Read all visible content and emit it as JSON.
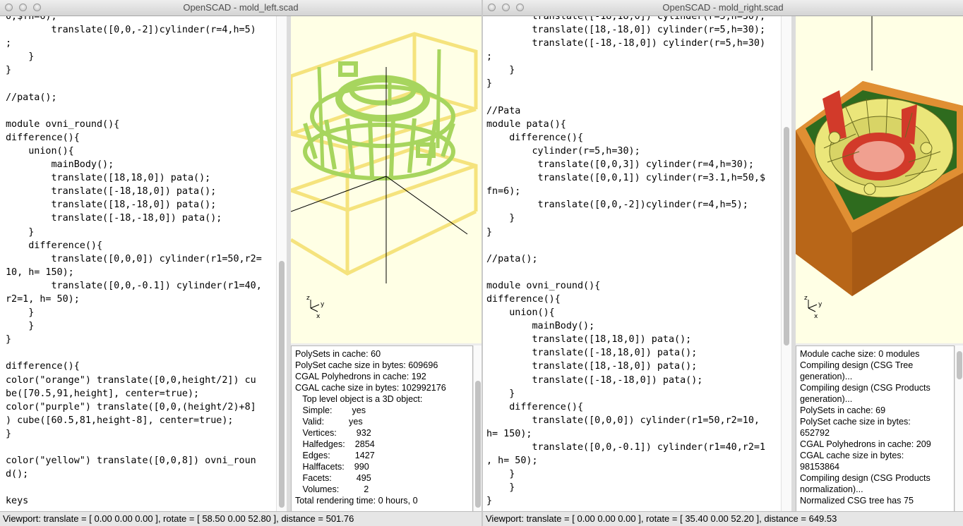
{
  "left": {
    "title": "OpenSCAD - mold_left.scad",
    "code": "0,$fn=6);\n        translate([0,0,-2])cylinder(r=4,h=5)\n;\n    }\n}\n\n//pata();\n\nmodule ovni_round(){\ndifference(){\n    union(){\n        mainBody();\n        translate([18,18,0]) pata();\n        translate([-18,18,0]) pata();\n        translate([18,-18,0]) pata();\n        translate([-18,-18,0]) pata();\n    }\n    difference(){\n        translate([0,0,0]) cylinder(r1=50,r2=\n10, h= 150);\n        translate([0,0,-0.1]) cylinder(r1=40,\nr2=1, h= 50);\n    }\n    }\n}\n\ndifference(){\ncolor(\"orange\") translate([0,0,height/2]) cu\nbe([70.5,91,height], center=true);\ncolor(\"purple\") translate([0,0,(height/2)+8]\n) cube([60.5,81,height-8], center=true);\n}\n\ncolor(\"yellow\") translate([0,0,8]) ovni_roun\nd();\n\nkeys",
    "console": [
      "PolySets in cache: 60",
      "PolySet cache size in bytes: 609696",
      "CGAL Polyhedrons in cache: 192",
      "CGAL cache size in bytes: 102992176",
      "   Top level object is a 3D object:",
      "   Simple:        yes",
      "   Valid:          yes",
      "   Vertices:        932",
      "   Halfedges:    2854",
      "   Edges:          1427",
      "   Halffacets:    990",
      "   Facets:          495",
      "   Volumes:          2",
      "Total rendering time: 0 hours, 0"
    ],
    "status": "Viewport: translate = [ 0.00 0.00 0.00 ], rotate = [ 58.50 0.00 52.80 ], distance = 501.76",
    "axes": {
      "x": "x",
      "y": "y",
      "z": "z"
    },
    "colors": {
      "model": "#b7e07a",
      "frame": "#f5e37d"
    }
  },
  "right": {
    "title": "OpenSCAD - mold_right.scad",
    "code": "        translate([-18,18,0]) cylinder(r=5,h=30);\n        translate([18,-18,0]) cylinder(r=5,h=30);\n        translate([-18,-18,0]) cylinder(r=5,h=30)\n;\n    }\n}\n\n//Pata\nmodule pata(){\n    difference(){\n        cylinder(r=5,h=30);\n         translate([0,0,3]) cylinder(r=4,h=30);\n         translate([0,0,1]) cylinder(r=3.1,h=50,$\nfn=6);\n         translate([0,0,-2])cylinder(r=4,h=5);\n    }\n}\n\n//pata();\n\nmodule ovni_round(){\ndifference(){\n    union(){\n        mainBody();\n        translate([18,18,0]) pata();\n        translate([-18,18,0]) pata();\n        translate([18,-18,0]) pata();\n        translate([-18,-18,0]) pata();\n    }\n    difference(){\n        translate([0,0,0]) cylinder(r1=50,r2=10,\nh= 150);\n        translate([0,0,-0.1]) cylinder(r1=40,r2=1\n, h= 50);\n    }\n    }\n}",
    "console": [
      "Module cache size: 0 modules",
      "Compiling design (CSG Tree",
      "generation)...",
      "Compiling design (CSG Products",
      "generation)...",
      "PolySets in cache: 69",
      "PolySet cache size in bytes:",
      "652792",
      "CGAL Polyhedrons in cache: 209",
      "CGAL cache size in bytes:",
      "98153864",
      "Compiling design (CSG Products",
      "normalization)...",
      "Normalized CSG tree has 75"
    ],
    "status": "Viewport: translate = [ 0.00 0.00 0.00 ], rotate = [ 35.40 0.00 52.20 ], distance = 649.53",
    "axes": {
      "x": "x",
      "y": "y",
      "z": "z"
    },
    "colors": {
      "box": "#c4701e",
      "inner": "#2e6b1e",
      "model": "#ebe67a",
      "hole": "#d23a2a"
    }
  }
}
